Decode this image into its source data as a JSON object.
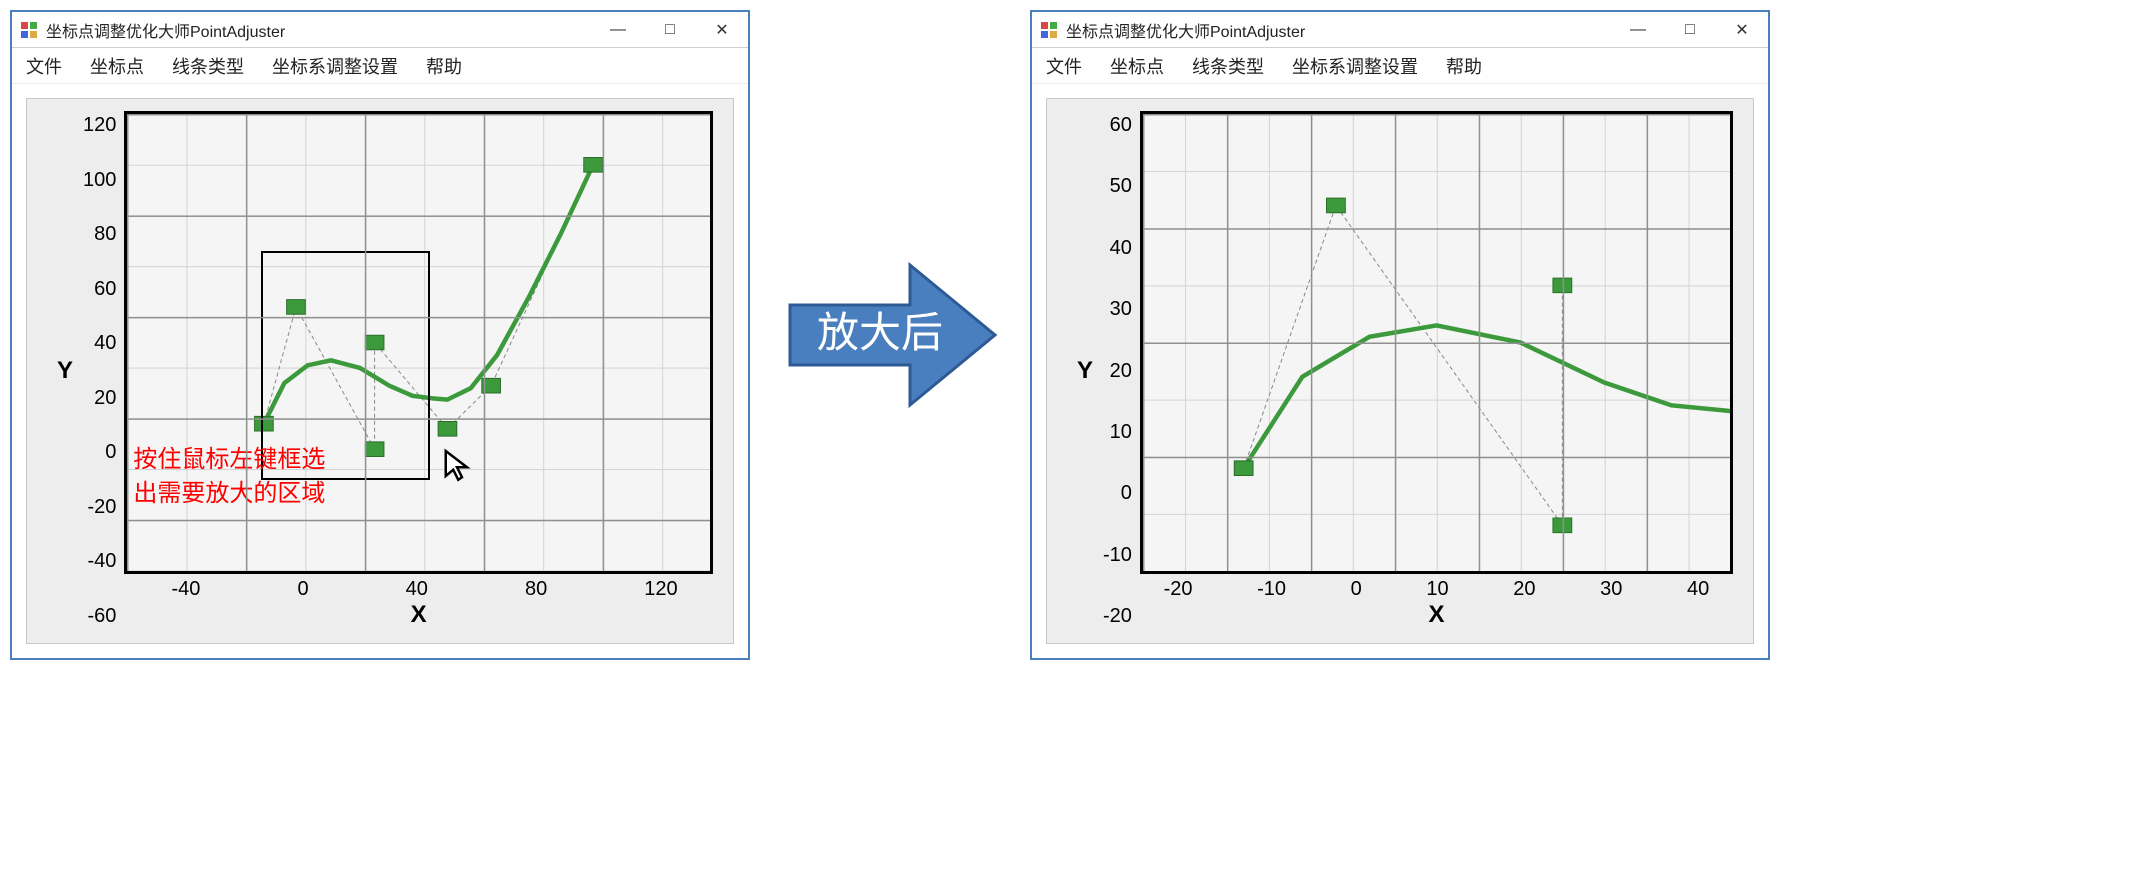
{
  "app_title": "坐标点调整优化大师PointAdjuster",
  "menu": {
    "file": "文件",
    "points": "坐标点",
    "line_type": "线条类型",
    "axis_settings": "坐标系调整设置",
    "help": "帮助"
  },
  "win_buttons": {
    "minimize": "—",
    "maximize": "□",
    "close": "✕"
  },
  "left": {
    "xlabel": "X",
    "ylabel": "Y",
    "y_ticks": [
      "120",
      "100",
      "80",
      "60",
      "40",
      "20",
      "0",
      "-20",
      "-40",
      "-60"
    ],
    "x_ticks": [
      "-40",
      "0",
      "40",
      "80",
      "120"
    ],
    "annotation_line1": "按住鼠标左键框选",
    "annotation_line2": "出需要放大的区域",
    "selection": {
      "x0": -14,
      "y0": -24,
      "x1": 44,
      "y1": 66
    }
  },
  "right": {
    "xlabel": "X",
    "ylabel": "Y",
    "y_ticks": [
      "60",
      "50",
      "40",
      "30",
      "20",
      "10",
      "0",
      "-10",
      "-20"
    ],
    "x_ticks": [
      "-20",
      "-10",
      "0",
      "10",
      "20",
      "30",
      "40"
    ]
  },
  "arrow_label": "放大后",
  "colors": {
    "curve": "#3c9a3c",
    "annotation": "#ff0000",
    "arrow": "#4a7fbf"
  },
  "chart_data": {
    "type": "line",
    "title": "",
    "xlabel": "X",
    "ylabel": "Y",
    "control_points": [
      {
        "x": -13,
        "y": -2
      },
      {
        "x": -2,
        "y": 44
      },
      {
        "x": 25,
        "y": -12
      },
      {
        "x": 25,
        "y": 30
      },
      {
        "x": 50,
        "y": -4
      },
      {
        "x": 65,
        "y": 13
      },
      {
        "x": 100,
        "y": 100
      }
    ],
    "curve_samples": [
      {
        "x": -13,
        "y": -2
      },
      {
        "x": -6,
        "y": 14
      },
      {
        "x": 2,
        "y": 21
      },
      {
        "x": 10,
        "y": 23
      },
      {
        "x": 20,
        "y": 20
      },
      {
        "x": 30,
        "y": 13
      },
      {
        "x": 38,
        "y": 9
      },
      {
        "x": 45,
        "y": 8
      },
      {
        "x": 50,
        "y": 7.5
      },
      {
        "x": 58,
        "y": 12
      },
      {
        "x": 67,
        "y": 25
      },
      {
        "x": 78,
        "y": 48
      },
      {
        "x": 89,
        "y": 73
      },
      {
        "x": 100,
        "y": 100
      }
    ],
    "left_view": {
      "xlim": [
        -60,
        140
      ],
      "ylim": [
        -60,
        120
      ]
    },
    "right_view": {
      "xlim": [
        -25,
        45
      ],
      "ylim": [
        -20,
        60
      ]
    }
  }
}
